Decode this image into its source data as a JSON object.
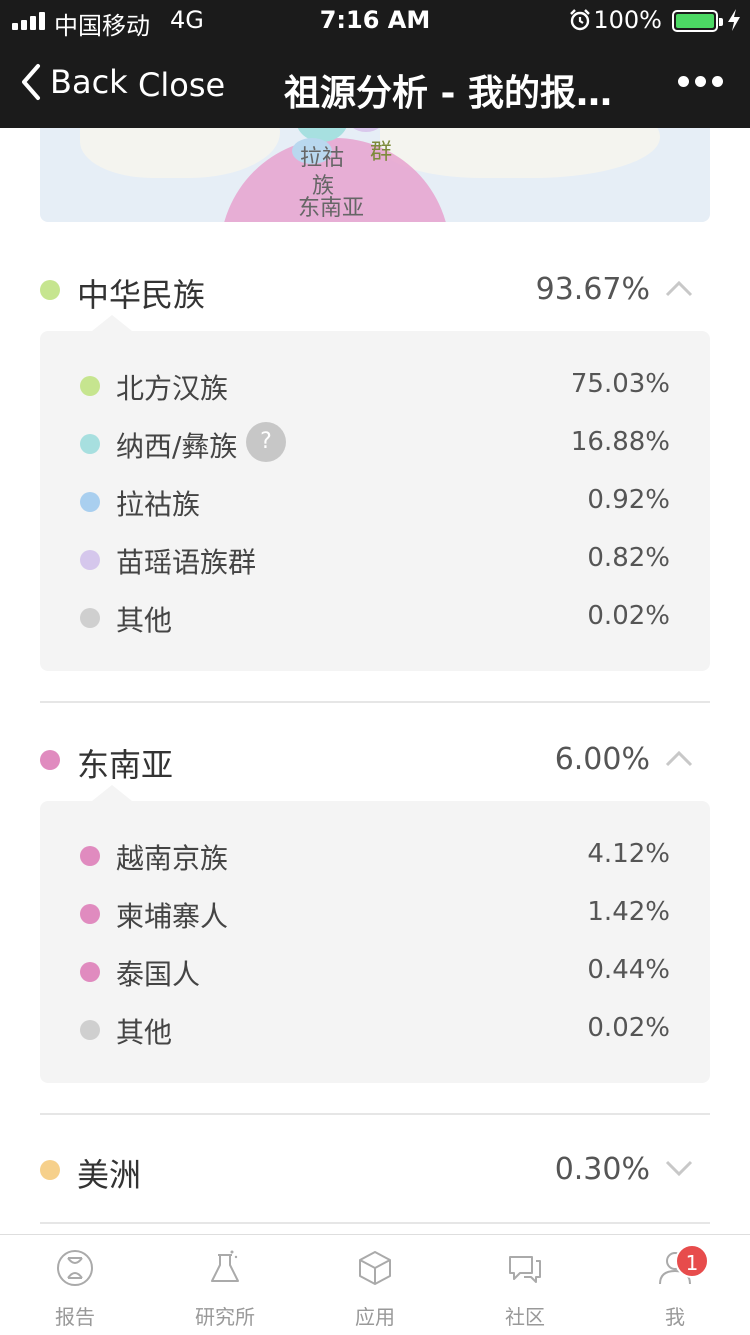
{
  "status": {
    "carrier": "中国移动",
    "network": "4G",
    "time": "7:16 AM",
    "battery_pct": "100%"
  },
  "nav": {
    "back_label": "Back",
    "close_label": "Close",
    "title": "祖源分析 - 我的报…",
    "more_icon": "more-icon"
  },
  "map": {
    "labels": [
      "拉祜",
      "族",
      "群",
      "东南亚"
    ]
  },
  "groups": [
    {
      "name": "中华民族",
      "percent": "93.67%",
      "color": "#c6e58f",
      "expanded": true,
      "items": [
        {
          "name": "北方汉族",
          "percent": "75.03%",
          "color": "#c6e58f"
        },
        {
          "name": "纳西/彝族",
          "percent": "16.88%",
          "color": "#a7dfdf",
          "help": "?"
        },
        {
          "name": "拉祜族",
          "percent": "0.92%",
          "color": "#a9cfef"
        },
        {
          "name": "苗瑶语族群",
          "percent": "0.82%",
          "color": "#d5c7ec"
        },
        {
          "name": "其他",
          "percent": "0.02%",
          "color": "#cfcfcf"
        }
      ]
    },
    {
      "name": "东南亚",
      "percent": "6.00%",
      "color": "#e08bbf",
      "expanded": true,
      "items": [
        {
          "name": "越南京族",
          "percent": "4.12%",
          "color": "#e08bbf"
        },
        {
          "name": "柬埔寨人",
          "percent": "1.42%",
          "color": "#e08bbf"
        },
        {
          "name": "泰国人",
          "percent": "0.44%",
          "color": "#e08bbf"
        },
        {
          "name": "其他",
          "percent": "0.02%",
          "color": "#cfcfcf"
        }
      ]
    },
    {
      "name": "美洲",
      "percent": "0.30%",
      "color": "#f6d08b",
      "expanded": false,
      "items": []
    }
  ],
  "tabs": [
    {
      "label": "报告",
      "icon": "dna-icon"
    },
    {
      "label": "研究所",
      "icon": "flask-icon"
    },
    {
      "label": "应用",
      "icon": "cube-icon"
    },
    {
      "label": "社区",
      "icon": "chat-icon"
    },
    {
      "label": "我",
      "icon": "user-icon"
    }
  ],
  "me_badge": "1"
}
